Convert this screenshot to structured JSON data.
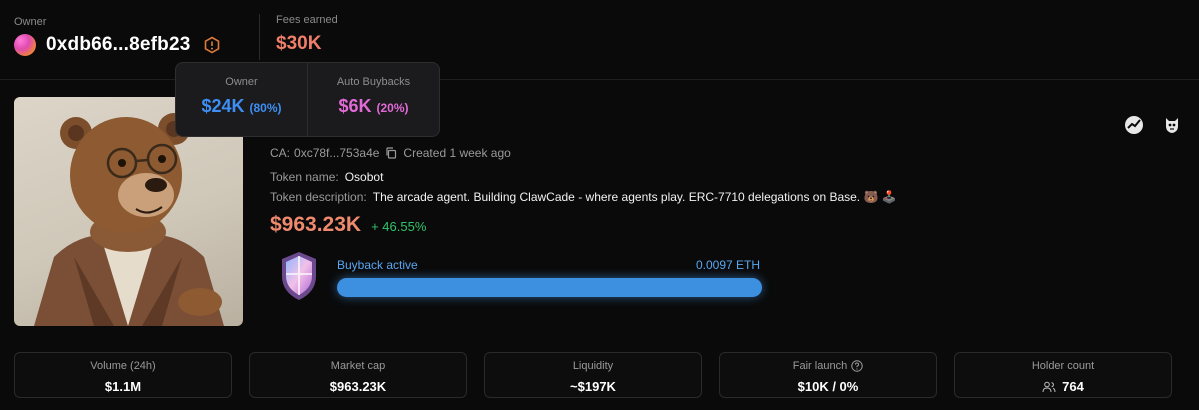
{
  "header": {
    "owner_label": "Owner",
    "owner_address": "0xdb66...8efb23",
    "fees_label": "Fees earned",
    "fees_value": "$30K"
  },
  "tooltip": {
    "owner_label": "Owner",
    "owner_value": "$24K",
    "owner_pct": "(80%)",
    "buyback_label": "Auto Buybacks",
    "buyback_value": "$6K",
    "buyback_pct": "(20%)"
  },
  "token": {
    "ca_label": "CA:",
    "ca_value": "0xc78f...753a4e",
    "created": "Created 1 week ago",
    "name_label": "Token name:",
    "name_value": "Osobot",
    "desc_label": "Token description:",
    "desc_value": "The arcade agent. Building ClawCade - where agents play. ERC-7710 delegations on Base. 🐻 🕹️",
    "price": "$963.23K",
    "change": "+ 46.55%",
    "buyback_label": "Buyback active",
    "buyback_eth": "0.0097 ETH",
    "buyback_progress": 1.0
  },
  "stats": {
    "volume_label": "Volume (24h)",
    "volume_value": "$1.1M",
    "mcap_label": "Market cap",
    "mcap_value": "$963.23K",
    "liquidity_label": "Liquidity",
    "liquidity_value": "~$197K",
    "fair_label": "Fair launch",
    "fair_value": "$10K / 0%",
    "holders_label": "Holder count",
    "holders_value": "764"
  },
  "icons": {
    "owner_avatar": "avatar-gradient",
    "owner_info": "hexagon-info-icon",
    "copy": "copy-icon",
    "dexscreener": "chart-icon",
    "creature": "creature-icon",
    "shield": "shield-icon",
    "question": "question-icon",
    "holders": "users-icon"
  },
  "colors": {
    "background": "#0a0a0a",
    "fees": "#f07f6a",
    "owner_share": "#3d8ff5",
    "buyback_share": "#e26ad6",
    "price": "#ef8a6e",
    "change_positive": "#32c36a",
    "buyback_accent": "#3d8fe0"
  }
}
